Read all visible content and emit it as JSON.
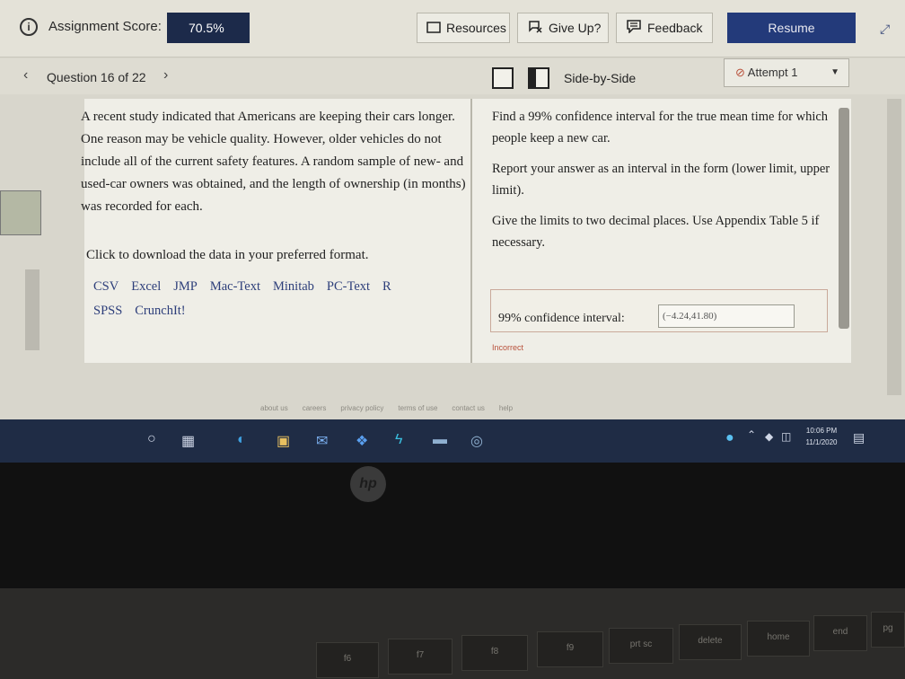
{
  "toolbar": {
    "score_label": "Assignment Score:",
    "score_value": "70.5%",
    "resources": "Resources",
    "give_up": "Give Up?",
    "feedback": "Feedback",
    "resume": "Resume"
  },
  "question_nav": {
    "label": "Question 16 of 22",
    "view_mode": "Side-by-Side",
    "attempt": "Attempt 1"
  },
  "problem": {
    "text": "A recent study indicated that Americans are keeping their cars longer. One reason may be vehicle quality. However, older vehicles do not include all of the current safety features. A random sample of new- and used-car owners was obtained, and the length of ownership (in months) was recorded for each.",
    "download_prompt": "Click to download the data in your preferred format.",
    "formats": [
      "CSV",
      "Excel",
      "JMP",
      "Mac-Text",
      "Minitab",
      "PC-Text",
      "R",
      "SPSS",
      "CrunchIt!"
    ]
  },
  "task": {
    "p1": "Find a 99% confidence interval for the true mean time for which people keep a new car.",
    "p2": "Report your answer as an interval in the form (lower limit, upper limit).",
    "p3": "Give the limits to two decimal places. Use Appendix Table 5 if necessary.",
    "answer_label": "99% confidence interval:",
    "answer_value": "(−4.24,41.80)",
    "status": "Incorrect"
  },
  "footer_links": [
    "about us",
    "careers",
    "privacy policy",
    "terms of use",
    "contact us",
    "help"
  ],
  "clock": {
    "time": "10:06 PM",
    "date": "11/1/2020"
  },
  "keys": [
    "f6",
    "f7",
    "f8",
    "f9",
    "f10",
    "prt sc",
    "delete",
    "home",
    "end",
    "pg"
  ]
}
